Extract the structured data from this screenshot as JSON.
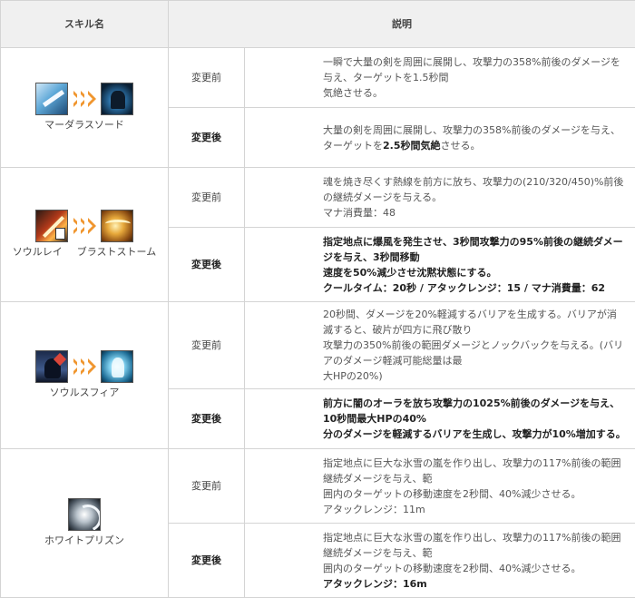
{
  "header": {
    "skill_name": "スキル名",
    "description": "説明"
  },
  "rows": [
    {
      "skill": {
        "names": [
          "マーダラスソード"
        ],
        "icons": [
          "sword-icon",
          "arrow-icon",
          "dark-warrior-icon"
        ]
      },
      "before": {
        "label": "変更前",
        "lines": [
          "一瞬で大量の剣を周囲に展開し、攻撃力の358%前後のダメージを与え、ターゲットを1.5秒間",
          "気絶させる。"
        ]
      },
      "after": {
        "label": "変更後",
        "prefix": "大量の剣を周囲に展開し、攻撃力の358%前後のダメージを与え、ターゲットを",
        "bold": "2.5秒間気絶",
        "suffix": "させる。"
      }
    },
    {
      "skill": {
        "names": [
          "ソウルレイ",
          "ブラストストーム"
        ],
        "icons": [
          "soul-ray-icon",
          "arrow-icon",
          "blast-storm-icon"
        ]
      },
      "before": {
        "label": "変更前",
        "lines": [
          "魂を焼き尽くす熱線を前方に放ち、攻撃力の(210/320/450)%前後の継続ダメージを与える。",
          "マナ消費量：48"
        ]
      },
      "after": {
        "label": "変更後",
        "lines": [
          "指定地点に爆風を発生させ、3秒間攻撃力の95%前後の継続ダメージを与え、3秒間移動",
          "速度を50%減少させ沈黙状態にする。",
          "クールタイム：20秒 / アタックレンジ：15 / マナ消費量：62"
        ]
      }
    },
    {
      "skill": {
        "names": [
          "ソウルスフィア"
        ],
        "icons": [
          "soul-sphere-old-icon",
          "arrow-icon",
          "soul-sphere-new-icon"
        ]
      },
      "before": {
        "label": "変更前",
        "lines": [
          "20秒間、ダメージを20%軽減するバリアを生成する。バリアが消滅すると、破片が四方に飛び散り",
          "攻撃力の350%前後の範囲ダメージとノックバックを与える。(バリアのダメージ軽減可能総量は最",
          "大HPの20%)"
        ]
      },
      "after": {
        "label": "変更後",
        "lines": [
          "前方に闇のオーラを放ち攻撃力の1025%前後のダメージを与え、10秒間最大HPの40%",
          "分のダメージを軽減するバリアを生成し、攻撃力が10%増加する。"
        ]
      }
    },
    {
      "skill": {
        "names": [
          "ホワイトプリズン"
        ],
        "icons": [
          "white-prison-icon"
        ]
      },
      "before": {
        "label": "変更前",
        "lines": [
          "指定地点に巨大な氷雪の嵐を作り出し、攻撃力の117%前後の範囲継続ダメージを与え、範",
          "囲内のターゲットの移動速度を2秒間、40%減少させる。",
          "アタックレンジ：11m"
        ]
      },
      "after": {
        "label": "変更後",
        "lines": [
          "指定地点に巨大な氷雪の嵐を作り出し、攻撃力の117%前後の範囲継続ダメージを与え、範",
          "囲内のターゲットの移動速度を2秒間、40%減少させる。"
        ],
        "bold_line": "アタックレンジ：16m"
      }
    }
  ],
  "colors": {
    "arrow": "#f0962f",
    "header_bg": "#f0f0f0",
    "border": "#d4d4d4"
  }
}
